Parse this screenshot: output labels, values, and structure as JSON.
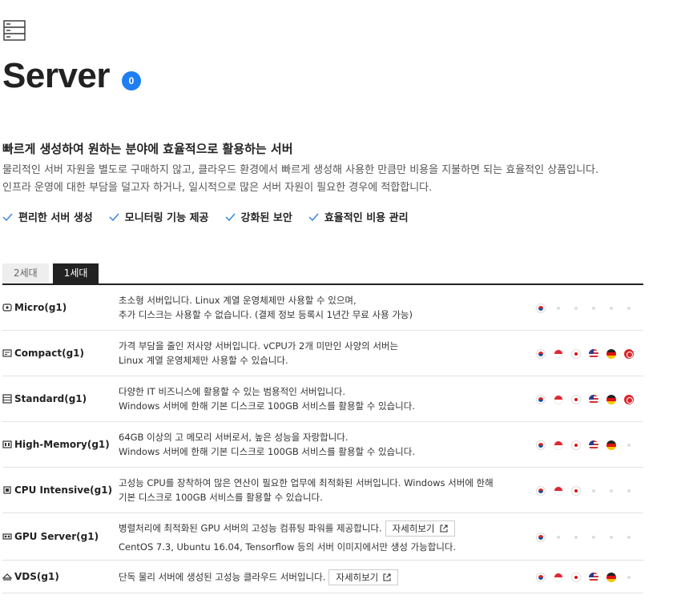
{
  "header": {
    "icon": "server-icon",
    "title": "Server",
    "badge": "0"
  },
  "intro": {
    "subtitle": "빠르게 생성하여 원하는 분야에 효율적으로 활용하는 서버",
    "lines": [
      "물리적인 서버 자원을 별도로 구매하지 않고, 클라우드 환경에서 빠르게 생성해 사용한 만큼만 비용을 지불하면 되는 효율적인 상품입니다.",
      "인프라 운영에 대한 부담을 덜고자 하거나, 일시적으로 많은 서버 자원이 필요한 경우에 적합합니다."
    ]
  },
  "features": [
    "편리한 서버 생성",
    "모니터링 기능 제공",
    "강화된 보안",
    "효율적인 비용 관리"
  ],
  "tabs": [
    {
      "label": "2세대",
      "active": false
    },
    {
      "label": "1세대",
      "active": true
    }
  ],
  "colors": {
    "accent": "#1f7ef1",
    "check": "#3a87d8",
    "dark": "#222222"
  },
  "rows": [
    {
      "name": "Micro(g1)",
      "icon": "micro-server-icon",
      "lines": [
        "초소형 서버입니다. Linux 계열 운영체제만 사용할 수 있으며,",
        "추가 디스크는 사용할 수 없습니다. (결제 정보 등록시 1년간 무료 사용 가능)"
      ],
      "regions": [
        "kr",
        "none",
        "none",
        "none",
        "none",
        "none"
      ]
    },
    {
      "name": "Compact(g1)",
      "icon": "compact-server-icon",
      "lines": [
        "가격 부담을 줄인 저사양 서버입니다. vCPU가 2개 미만인 사양의 서버는",
        "Linux 계열 운영체제만 사용할 수 있습니다."
      ],
      "regions": [
        "kr",
        "sg",
        "jp",
        "us",
        "de",
        "hk"
      ]
    },
    {
      "name": "Standard(g1)",
      "icon": "standard-server-icon",
      "lines": [
        "다양한 IT 비즈니스에 활용할 수 있는 범용적인 서버입니다.",
        "Windows 서버에 한해 기본 디스크로 100GB 서비스를 활용할 수 있습니다."
      ],
      "regions": [
        "kr",
        "sg",
        "jp",
        "us",
        "de",
        "hk"
      ]
    },
    {
      "name": "High-Memory(g1)",
      "icon": "high-memory-server-icon",
      "lines": [
        "64GB 이상의 고 메모리 서버로서, 높은 성능을 자랑합니다.",
        "Windows 서버에 한해 기본 디스크로 100GB 서비스를 활용할 수 있습니다."
      ],
      "regions": [
        "kr",
        "sg",
        "jp",
        "us",
        "de",
        "none"
      ]
    },
    {
      "name": "CPU Intensive(g1)",
      "icon": "cpu-intensive-server-icon",
      "lines": [
        "고성능 CPU를 장착하여 많은 연산이 필요한 업무에 최적화된 서버입니다. Windows 서버에 한해",
        "기본 디스크로 100GB 서비스를 활용할 수 있습니다."
      ],
      "regions": [
        "kr",
        "sg",
        "jp",
        "none",
        "none",
        "none"
      ]
    },
    {
      "name": "GPU Server(g1)",
      "icon": "gpu-server-icon",
      "lines": [
        "병렬처리에 최적화된 GPU 서버의 고성능 컴퓨팅 파워를 제공합니다.",
        "CentOS 7.3, Ubuntu 16.04, Tensorflow 등의 서버 이미지에서만 생성 가능합니다."
      ],
      "more": "자세히보기",
      "regions": [
        "kr",
        "none",
        "none",
        "none",
        "none",
        "none"
      ]
    },
    {
      "name": "VDS(g1)",
      "icon": "vds-server-icon",
      "lines": [
        "단독 물리 서버에 생성된 고성능 클라우드 서버입니다."
      ],
      "more": "자세히보기",
      "regions": [
        "kr",
        "sg",
        "jp",
        "us",
        "de",
        "none"
      ]
    }
  ]
}
